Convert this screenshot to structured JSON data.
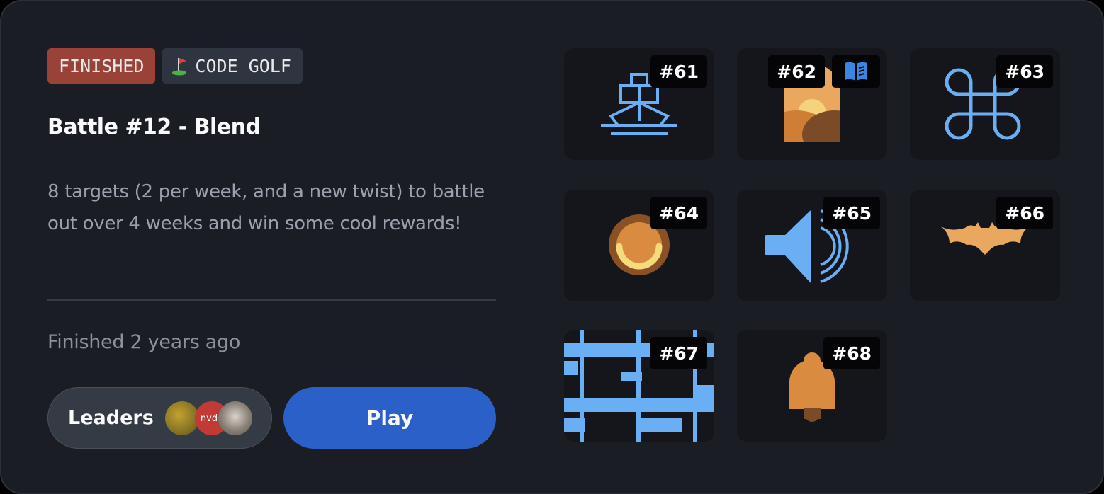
{
  "battle": {
    "status_tag": "FINISHED",
    "category_tag": "CODE GOLF",
    "title": "Battle #12 - Blend",
    "description": "8 targets (2 per week, and a new twist) to battle out over 4 weeks and win some cool rewards!",
    "finished_text": "Finished 2 years ago",
    "leaders_label": "Leaders",
    "play_label": "Play",
    "avatar_text": "nvdo"
  },
  "targets": [
    {
      "id": "#61",
      "icon": "ship-icon"
    },
    {
      "id": "#62",
      "icon": "sunset-arch-icon",
      "extra": "book-icon"
    },
    {
      "id": "#63",
      "icon": "command-key-icon"
    },
    {
      "id": "#64",
      "icon": "ring-smile-icon"
    },
    {
      "id": "#65",
      "icon": "speaker-icon"
    },
    {
      "id": "#66",
      "icon": "bat-icon"
    },
    {
      "id": "#67",
      "icon": "lattice-icon"
    },
    {
      "id": "#68",
      "icon": "bell-icon"
    }
  ],
  "colors": {
    "accent_blue": "#2c60c9",
    "finished_red": "#9a4238",
    "icon_blue": "#6aaef3",
    "icon_orange": "#d98c3f",
    "card_bg": "#1a1d24"
  }
}
